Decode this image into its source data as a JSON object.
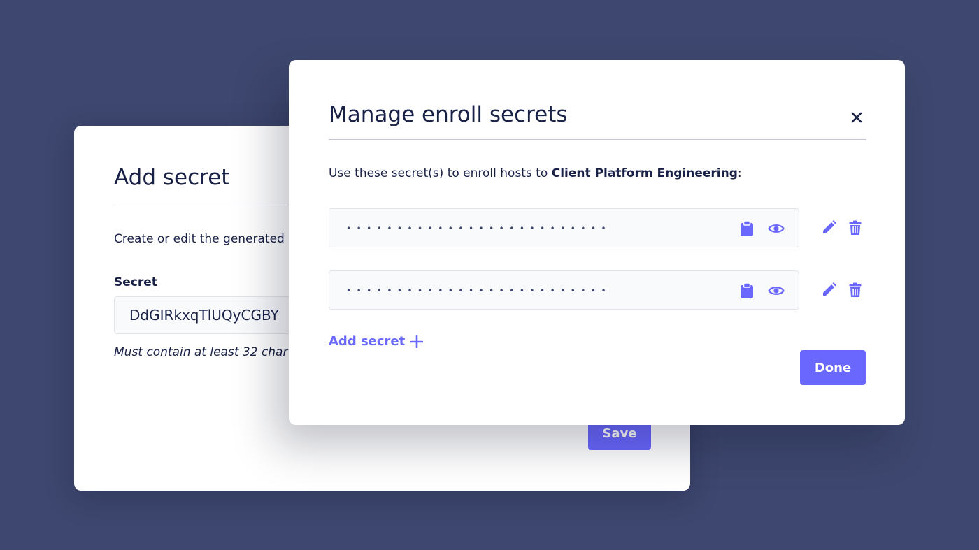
{
  "add_secret_modal": {
    "title": "Add secret",
    "description": "Create or edit the generated",
    "secret_label": "Secret",
    "secret_value": "DdGIRkxqTlUQyCGBY",
    "hint": "Must contain at least 32 char",
    "save_label": "Save"
  },
  "enroll_modal": {
    "title": "Manage enroll secrets",
    "description_prefix": "Use these secret(s) to enroll hosts to ",
    "team_name": "Client Platform Engineering",
    "description_suffix": ":",
    "secrets": [
      {
        "masked": "••••••••••••••••••••••••••"
      },
      {
        "masked": "••••••••••••••••••••••••••"
      }
    ],
    "add_secret_label": "Add secret",
    "done_label": "Done"
  },
  "colors": {
    "background": "#3e476f",
    "accent": "#6a67fe",
    "text": "#192147"
  },
  "icons": [
    "close-icon",
    "clipboard-icon",
    "eye-icon",
    "edit-icon",
    "trash-icon",
    "plus-icon"
  ]
}
